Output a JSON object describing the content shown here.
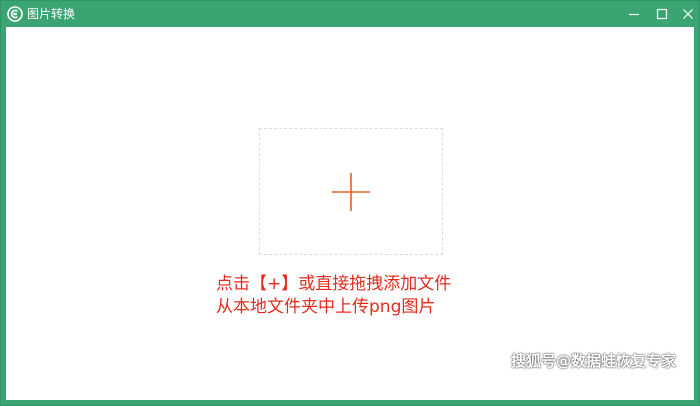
{
  "window": {
    "title": "图片转换",
    "icon": "app-logo-icon",
    "controls": {
      "minimize_icon": "minimize-icon",
      "maximize_icon": "maximize-icon",
      "close_icon": "close-icon"
    }
  },
  "drop_zone": {
    "icon": "plus-icon",
    "instruction_line1": "点击【+】或直接拖拽添加文件",
    "instruction_line2": "从本地文件夹中上传png图片"
  },
  "watermark": "搜狐号@数据蛙恢复专家",
  "colors": {
    "frame": "#3aa573",
    "accent": "#e8602c",
    "instruction_text": "#e22d1e",
    "dash_border": "#d9dde2"
  }
}
